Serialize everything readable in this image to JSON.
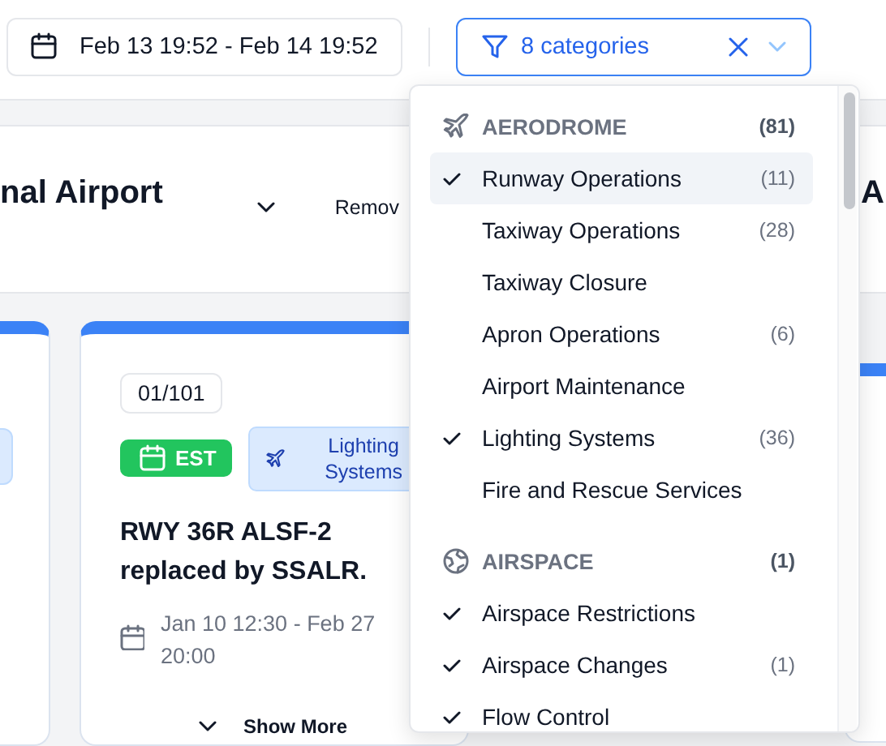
{
  "toolbar": {
    "date_range": "Feb 13 19:52 - Feb 14 19:52",
    "filter": {
      "label": "8 categories"
    }
  },
  "header": {
    "title": "nal Airport",
    "action": "Remov",
    "next_title": "A"
  },
  "cards": [
    {
      "kind": "partial"
    },
    {
      "kind": "notice",
      "number": "01/101",
      "status": "EST",
      "category": "Lighting Systems",
      "title": "RWY 36R ALSF-2 replaced by SSALR.",
      "period": "Jan 10 12:30 - Feb 27 20:00",
      "show_more": "Show More"
    },
    {
      "kind": "edge"
    }
  ],
  "dropdown": {
    "groups": [
      {
        "name": "AERODROME",
        "count": "(81)",
        "items": [
          {
            "label": "Runway Operations",
            "count": "(11)",
            "checked": true,
            "highlighted": true
          },
          {
            "label": "Taxiway Operations",
            "count": "(28)",
            "checked": false,
            "highlighted": false
          },
          {
            "label": "Taxiway Closure",
            "checked": false,
            "highlighted": false
          },
          {
            "label": "Apron Operations",
            "count": "(6)",
            "checked": false,
            "highlighted": false
          },
          {
            "label": "Airport Maintenance",
            "checked": false,
            "highlighted": false
          },
          {
            "label": "Lighting Systems",
            "count": "(36)",
            "checked": true,
            "highlighted": false
          },
          {
            "label": "Fire and Rescue Services",
            "checked": false,
            "highlighted": false
          }
        ]
      },
      {
        "name": "AIRSPACE",
        "count": "(1)",
        "items": [
          {
            "label": "Airspace Restrictions",
            "checked": true,
            "highlighted": false
          },
          {
            "label": "Airspace Changes",
            "count": "(1)",
            "checked": true,
            "highlighted": false
          },
          {
            "label": "Flow Control",
            "checked": true,
            "highlighted": false
          }
        ]
      }
    ]
  }
}
